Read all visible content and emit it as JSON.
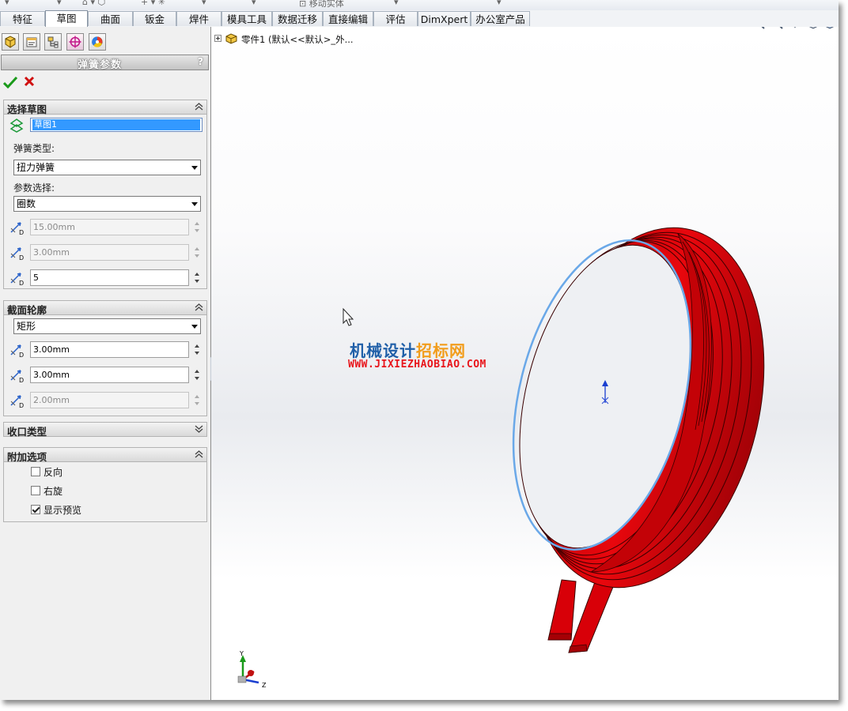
{
  "top_toolbar": {
    "partial_label": "移动实体"
  },
  "tabs": [
    {
      "label": "特征",
      "active": false
    },
    {
      "label": "草图",
      "active": true
    },
    {
      "label": "曲面",
      "active": false
    },
    {
      "label": "钣金",
      "active": false
    },
    {
      "label": "焊件",
      "active": false
    },
    {
      "label": "模具工具",
      "active": false
    },
    {
      "label": "数据迁移",
      "active": false
    },
    {
      "label": "直接编辑",
      "active": false
    },
    {
      "label": "评估",
      "active": false
    },
    {
      "label": "DimXpert",
      "active": false
    },
    {
      "label": "办公室产品",
      "active": false
    }
  ],
  "property_manager": {
    "title": "弹簧参数",
    "help": "?",
    "groups": {
      "select_sketch": {
        "label": "选择草图",
        "selected_item": "草图1",
        "spring_type_label": "弹簧类型:",
        "spring_type_value": "扭力弹簧",
        "param_label": "参数选择:",
        "param_value": "圈数",
        "params": [
          "15.00mm",
          "3.00mm",
          "5"
        ]
      },
      "section_profile": {
        "label": "截面轮廓",
        "profile_value": "矩形",
        "params": [
          "3.00mm",
          "3.00mm",
          "2.00mm"
        ]
      },
      "end_type": {
        "label": "收口类型"
      },
      "extra_options": {
        "label": "附加选项",
        "options": [
          {
            "label": "反向",
            "checked": false
          },
          {
            "label": "右旋",
            "checked": false
          },
          {
            "label": "显示预览",
            "checked": true
          }
        ]
      }
    }
  },
  "feature_tree": {
    "label": "零件1  (默认<<默认>_外..."
  },
  "watermark": {
    "line1_a": "机械设计",
    "line1_b": "招标网",
    "line2": "WWW.JIXIEZHAOBIAO.COM"
  },
  "colors": {
    "spring_red": "#e8070d",
    "spring_dark": "#7e0206",
    "preview_blue": "#6aa8e8",
    "accent_green": "#1a9a1a",
    "cancel_red": "#d01010"
  }
}
